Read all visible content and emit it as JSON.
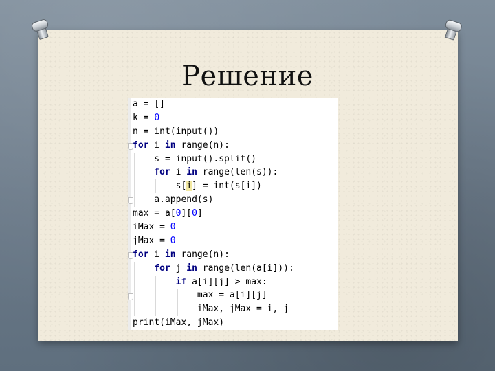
{
  "slide": {
    "title": "Решение"
  },
  "code": {
    "language": "python",
    "lines": [
      "a = []",
      "k = 0",
      "n = int(input())",
      "for i in range(n):",
      "    s = input().split()",
      "    for i in range(len(s)):",
      "        s[i] = int(s[i])",
      "    a.append(s)",
      "max = a[0][0]",
      "iMax = 0",
      "jMax = 0",
      "for i in range(n):",
      "    for j in range(len(a[i])):",
      "        if a[i][j] > max:",
      "            max = a[i][j]",
      "            iMax, jMax = i, j",
      "print(iMax, jMax)"
    ]
  },
  "colors": {
    "keyword": "#000080",
    "number": "#0000ff",
    "text": "#000000",
    "paper": "#f1ebdc",
    "background": "#6f7f8e",
    "highlight": "#f3e9a2"
  },
  "icons": [
    "pushpin-icon",
    "pushpin-icon"
  ]
}
